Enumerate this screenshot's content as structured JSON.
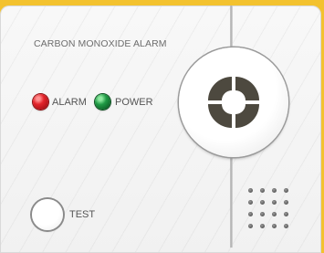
{
  "device": {
    "title": "CARBON MONOXIDE ALARM",
    "alarm_label": "ALARM",
    "power_label": "POWER",
    "test_label": "TEST",
    "colors": {
      "background": "#f3c22f",
      "alarm_led": "#e3242b",
      "power_led": "#1f9a45",
      "icon": "#4d493f"
    },
    "icons": {
      "center_button": "four-segment-ring-icon",
      "speaker": "speaker-grille-icon"
    }
  }
}
